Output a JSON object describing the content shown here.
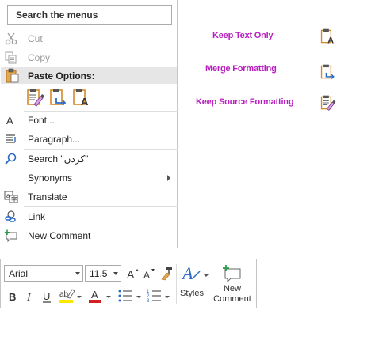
{
  "context_menu": {
    "search_label": "Search the menus",
    "items": {
      "cut": "Cut",
      "copy": "Copy",
      "paste_options": "Paste Options:",
      "font": "Font...",
      "paragraph": "Paragraph...",
      "search": "Search \"کردن\"",
      "synonyms": "Synonyms",
      "translate": "Translate",
      "link": "Link",
      "new_comment": "New Comment"
    }
  },
  "paste_legend": {
    "keep_text_only": "Keep Text Only",
    "merge_formatting": "Merge Formatting",
    "keep_source_formatting": "Keep Source Formatting"
  },
  "mini_toolbar": {
    "font_name": "Arial",
    "font_size": "11.5",
    "styles_label": "Styles",
    "new_comment_line1": "New",
    "new_comment_line2": "Comment"
  },
  "colors": {
    "legend_text": "#b81fbf",
    "highlight": "#ffe600",
    "font_color": "#d21f1f",
    "accent_blue": "#2b6cc4",
    "clipboard_orange": "#d38a2a"
  }
}
